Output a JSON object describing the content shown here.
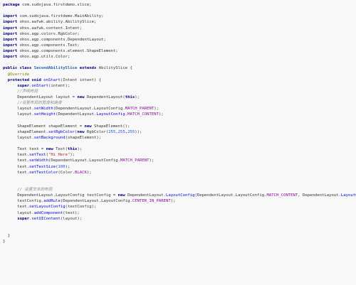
{
  "code": {
    "lines": [
      [
        [
          "kw",
          "package"
        ],
        [
          "plain",
          " com.sudojava.firstdemo.slice;"
        ]
      ],
      [],
      [
        [
          "kw",
          "import"
        ],
        [
          "plain",
          " com.sudojava.firstdemo.MainAbility;"
        ]
      ],
      [
        [
          "kw",
          "import"
        ],
        [
          "plain",
          " ohos.aafwk.ability.AbilitySlice;"
        ]
      ],
      [
        [
          "kw",
          "import"
        ],
        [
          "plain",
          " ohos.aafwk.content.Intent;"
        ]
      ],
      [
        [
          "kw",
          "import"
        ],
        [
          "plain",
          " ohos.agp.colors.RgbColor;"
        ]
      ],
      [
        [
          "kw",
          "import"
        ],
        [
          "plain",
          " ohos.agp.components.DependentLayout;"
        ]
      ],
      [
        [
          "kw",
          "import"
        ],
        [
          "plain",
          " ohos.agp.components.Text;"
        ]
      ],
      [
        [
          "kw",
          "import"
        ],
        [
          "plain",
          " ohos.agp.components.element.ShapeElement;"
        ]
      ],
      [
        [
          "kw",
          "import"
        ],
        [
          "plain",
          " ohos.agp.utils.Color;"
        ]
      ],
      [],
      [
        [
          "kw",
          "public class "
        ],
        [
          "cls",
          "SecondAbilitySlice"
        ],
        [
          "kw",
          " extends "
        ],
        [
          "plain",
          "AbilitySlice {"
        ]
      ],
      [
        [
          "plain",
          "  "
        ],
        [
          "ann",
          "@Override"
        ]
      ],
      [
        [
          "plain",
          "  "
        ],
        [
          "kw",
          "protected void "
        ],
        [
          "mth",
          "onStart"
        ],
        [
          "plain",
          "(Intent intent) {"
        ]
      ],
      [
        [
          "plain",
          "      "
        ],
        [
          "kw",
          "super"
        ],
        [
          "plain",
          "."
        ],
        [
          "mth",
          "onStart"
        ],
        [
          "plain",
          "(intent);"
        ]
      ],
      [
        [
          "plain",
          "      "
        ],
        [
          "cm",
          "//声明布局"
        ]
      ],
      [
        [
          "plain",
          "      DependentLayout layout = "
        ],
        [
          "kw",
          "new "
        ],
        [
          "plain",
          "DependentLayout("
        ],
        [
          "kw",
          "this"
        ],
        [
          "plain",
          ");"
        ]
      ],
      [
        [
          "plain",
          "      "
        ],
        [
          "cm",
          "//设置布局的宽度和高度"
        ]
      ],
      [
        [
          "plain",
          "      layout."
        ],
        [
          "mth",
          "setWidth"
        ],
        [
          "plain",
          "(DependentLayout.LayoutConfig."
        ],
        [
          "fld",
          "MATCH_PARENT"
        ],
        [
          "plain",
          ");"
        ]
      ],
      [
        [
          "plain",
          "      layout."
        ],
        [
          "mth",
          "setHeight"
        ],
        [
          "plain",
          "(DependentLayout."
        ],
        [
          "mth",
          "LayoutConfig"
        ],
        [
          "plain",
          "."
        ],
        [
          "fld",
          "MATCH_CONTENT"
        ],
        [
          "plain",
          ");"
        ]
      ],
      [],
      [
        [
          "plain",
          "      ShapeElement shapeElement = "
        ],
        [
          "kw",
          "new "
        ],
        [
          "plain",
          "ShapeElement();"
        ]
      ],
      [
        [
          "plain",
          "      shapeElement."
        ],
        [
          "mth",
          "setRgbColor"
        ],
        [
          "plain",
          "("
        ],
        [
          "kw",
          "new "
        ],
        [
          "plain",
          "RgbColor("
        ],
        [
          "num",
          "255"
        ],
        [
          "plain",
          ","
        ],
        [
          "num",
          "255"
        ],
        [
          "plain",
          ","
        ],
        [
          "num",
          "255"
        ],
        [
          "plain",
          "));"
        ]
      ],
      [
        [
          "plain",
          "      layout."
        ],
        [
          "mth",
          "setBackground"
        ],
        [
          "plain",
          "(shapeElement);"
        ]
      ],
      [],
      [
        [
          "plain",
          "      Text text = "
        ],
        [
          "kw",
          "new "
        ],
        [
          "plain",
          "Text("
        ],
        [
          "kw",
          "this"
        ],
        [
          "plain",
          ");"
        ]
      ],
      [
        [
          "plain",
          "      text."
        ],
        [
          "mth",
          "setText"
        ],
        [
          "plain",
          "("
        ],
        [
          "str",
          "\"Hi Here\""
        ],
        [
          "plain",
          ");"
        ]
      ],
      [
        [
          "plain",
          "      text."
        ],
        [
          "mth",
          "setWidth"
        ],
        [
          "plain",
          "(DependentLayout.LayoutConfig."
        ],
        [
          "fld",
          "MATCH_PARENT"
        ],
        [
          "plain",
          ");"
        ]
      ],
      [
        [
          "plain",
          "      text."
        ],
        [
          "mth",
          "setTextSize"
        ],
        [
          "plain",
          "("
        ],
        [
          "num",
          "100"
        ],
        [
          "plain",
          ");"
        ]
      ],
      [
        [
          "plain",
          "      text."
        ],
        [
          "mth",
          "setTextColor"
        ],
        [
          "plain",
          "(Color."
        ],
        [
          "fld",
          "BLACK"
        ],
        [
          "plain",
          ");"
        ]
      ],
      [],
      [],
      [
        [
          "plain",
          "      "
        ],
        [
          "cm",
          "// 设置文本的布局"
        ]
      ],
      [
        [
          "plain",
          "      DependentLayout.LayoutConfig textConfig = "
        ],
        [
          "kw",
          "new "
        ],
        [
          "plain",
          "DependentLayout."
        ],
        [
          "mth",
          "LayoutConfig"
        ],
        [
          "plain",
          "(DependentLayout.LayoutConfig."
        ],
        [
          "fld",
          "MATCH_CONTENT"
        ],
        [
          "plain",
          ", DependentLayout."
        ],
        [
          "mth",
          "LayoutConfig"
        ],
        [
          "plain",
          "."
        ],
        [
          "fld",
          "MATCH_CONTENT"
        ],
        [
          "plain",
          ");"
        ]
      ],
      [
        [
          "plain",
          "      textConfig."
        ],
        [
          "mth",
          "addRule"
        ],
        [
          "plain",
          "(DependentLayout.LayoutConfig."
        ],
        [
          "fld",
          "CENTER_IN_PARENT"
        ],
        [
          "plain",
          ");"
        ]
      ],
      [
        [
          "plain",
          "      text."
        ],
        [
          "mth",
          "setLayoutConfig"
        ],
        [
          "plain",
          "(textConfig);"
        ]
      ],
      [
        [
          "plain",
          "      layout."
        ],
        [
          "mth",
          "addComponent"
        ],
        [
          "plain",
          "(text);"
        ]
      ],
      [
        [
          "plain",
          "      "
        ],
        [
          "kw",
          "super"
        ],
        [
          "plain",
          "."
        ],
        [
          "mth",
          "setUIContent"
        ],
        [
          "plain",
          "(layout);"
        ]
      ],
      [],
      [],
      [
        [
          "plain",
          "  }"
        ]
      ],
      [
        [
          "plain",
          "}"
        ]
      ]
    ]
  }
}
